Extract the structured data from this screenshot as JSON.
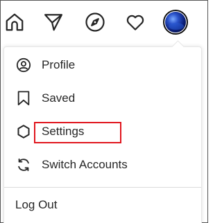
{
  "nav": {
    "icons": [
      "home-icon",
      "direct-send-icon",
      "compass-icon",
      "heart-icon",
      "avatar"
    ]
  },
  "menu": {
    "items": [
      {
        "label": "Profile",
        "icon": "user-circle-icon"
      },
      {
        "label": "Saved",
        "icon": "bookmark-icon"
      },
      {
        "label": "Settings",
        "icon": "gear-icon",
        "highlighted": true
      },
      {
        "label": "Switch Accounts",
        "icon": "switch-arrows-icon"
      }
    ],
    "logout_label": "Log Out"
  },
  "colors": {
    "text": "#262626",
    "highlight": "#e0141c",
    "divider": "#dbdbdb"
  }
}
